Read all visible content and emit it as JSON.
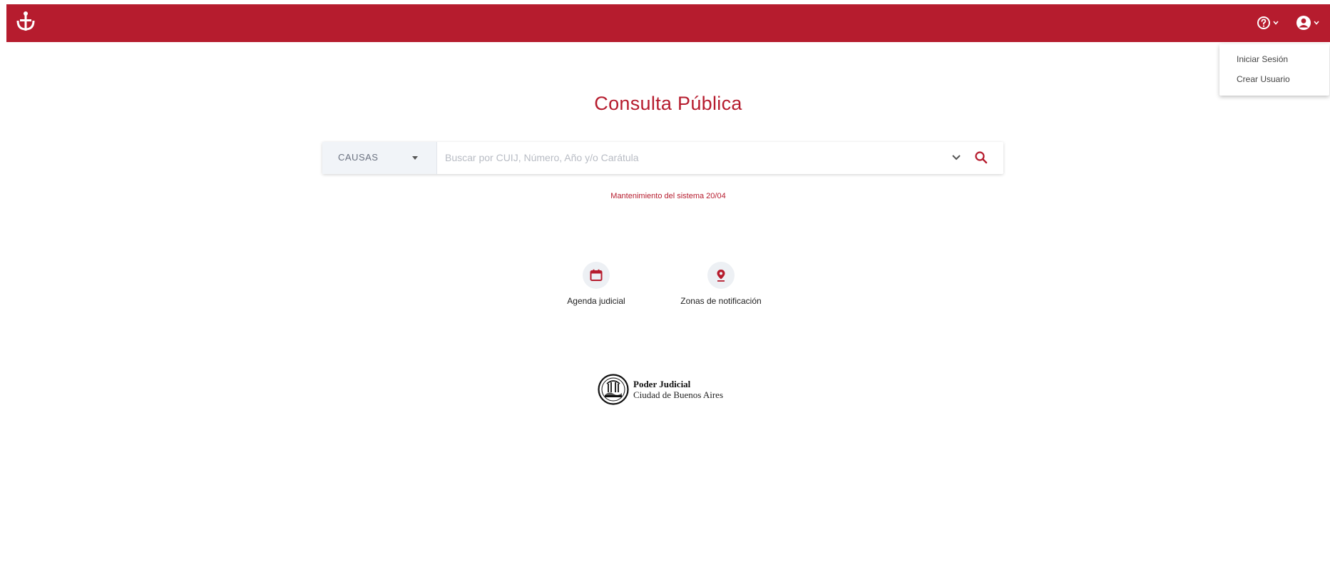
{
  "header": {
    "logo_icon": "pj-scales-logo-icon",
    "help_icon": "question-circle-icon",
    "user_icon": "user-circle-icon",
    "accent_color": "#b61c2e"
  },
  "user_menu": {
    "items": [
      {
        "label": "Iniciar Sesión"
      },
      {
        "label": "Crear Usuario"
      }
    ]
  },
  "main": {
    "title": "Consulta Pública",
    "search": {
      "type_selected": "CAUSAS",
      "placeholder": "Buscar por CUIJ, Número, Año y/o Carátula",
      "value": ""
    },
    "notice": "Mantenimiento del sistema 20/04",
    "shortcuts": [
      {
        "label": "Agenda judicial",
        "icon": "calendar-icon"
      },
      {
        "label": "Zonas de notificación",
        "icon": "map-pin-icon"
      }
    ]
  },
  "footer": {
    "org_line1": "Poder Judicial",
    "org_line2": "Ciudad de Buenos Aires"
  }
}
